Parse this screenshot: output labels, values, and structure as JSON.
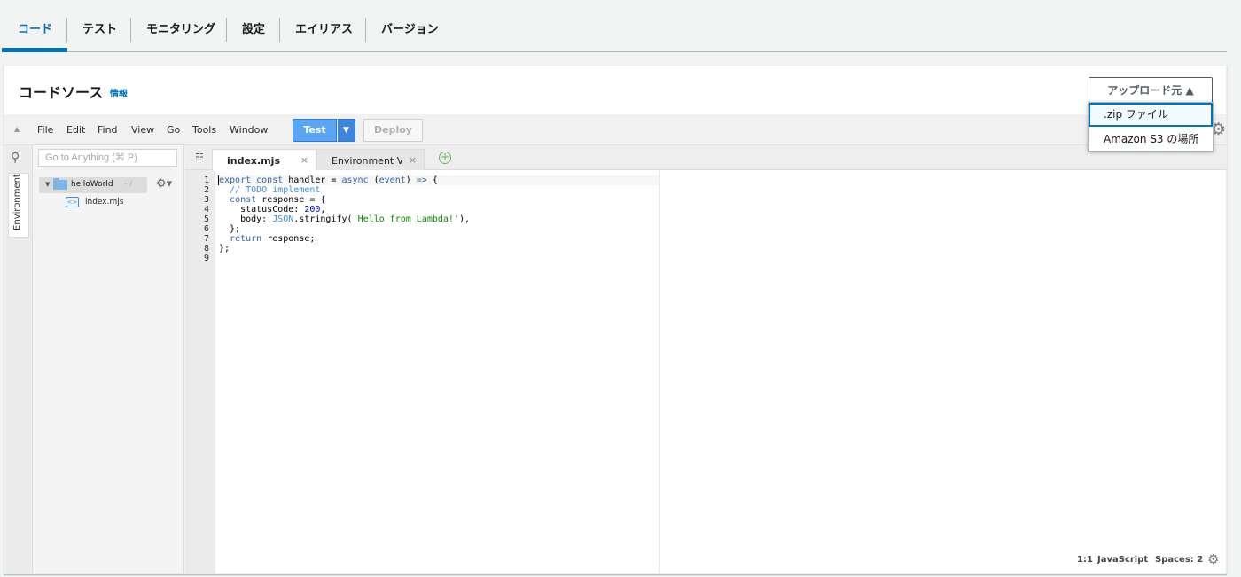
{
  "tabs": [
    {
      "label": "コード",
      "active": true
    },
    {
      "label": "テスト"
    },
    {
      "label": "モニタリング"
    },
    {
      "label": "設定"
    },
    {
      "label": "エイリアス"
    },
    {
      "label": "バージョン"
    }
  ],
  "panel": {
    "title": "コードソース",
    "info": "情報",
    "upload_button": "アップロード元 ▲",
    "upload_menu": [
      ".zip ファイル",
      "Amazon S3 の場所"
    ]
  },
  "ide": {
    "menu": [
      "File",
      "Edit",
      "Find",
      "View",
      "Go",
      "Tools",
      "Window"
    ],
    "test_label": "Test",
    "deploy_label": "Deploy",
    "goto_placeholder": "Go to Anything (⌘ P)",
    "rail_tab": "Environment",
    "tree": {
      "root": "helloWorld",
      "root_path": "- /",
      "file": "index.mjs"
    },
    "editor_tabs": [
      {
        "label": "index.mjs",
        "active": true
      },
      {
        "label": "Environment Variables"
      }
    ],
    "status": {
      "position": "1:1",
      "language": "JavaScript",
      "indent": "Spaces: 2"
    }
  },
  "code": {
    "line_numbers": [
      "1",
      "2",
      "3",
      "4",
      "5",
      "6",
      "7",
      "8",
      "9"
    ],
    "lines": [
      [
        {
          "t": "export const",
          "c": "kw"
        },
        {
          "t": " handler = ",
          "c": ""
        },
        {
          "t": "async",
          "c": "kw"
        },
        {
          "t": " (",
          "c": ""
        },
        {
          "t": "event",
          "c": "kw"
        },
        {
          "t": ") ",
          "c": ""
        },
        {
          "t": "=>",
          "c": "kw"
        },
        {
          "t": " {",
          "c": ""
        }
      ],
      [
        {
          "t": "  ",
          "c": ""
        },
        {
          "t": "// TODO implement",
          "c": "cm"
        }
      ],
      [
        {
          "t": "  ",
          "c": ""
        },
        {
          "t": "const",
          "c": "kw"
        },
        {
          "t": " response = {",
          "c": ""
        }
      ],
      [
        {
          "t": "    statusCode: ",
          "c": ""
        },
        {
          "t": "200",
          "c": "num"
        },
        {
          "t": ",",
          "c": ""
        }
      ],
      [
        {
          "t": "    body: ",
          "c": ""
        },
        {
          "t": "JSON",
          "c": "lib"
        },
        {
          "t": ".stringify(",
          "c": ""
        },
        {
          "t": "'Hello from Lambda!'",
          "c": "str"
        },
        {
          "t": "),",
          "c": ""
        }
      ],
      [
        {
          "t": "  };",
          "c": ""
        }
      ],
      [
        {
          "t": "  ",
          "c": ""
        },
        {
          "t": "return",
          "c": "kw"
        },
        {
          "t": " response;",
          "c": ""
        }
      ],
      [
        {
          "t": "};",
          "c": ""
        }
      ],
      [
        {
          "t": "",
          "c": ""
        }
      ]
    ]
  }
}
